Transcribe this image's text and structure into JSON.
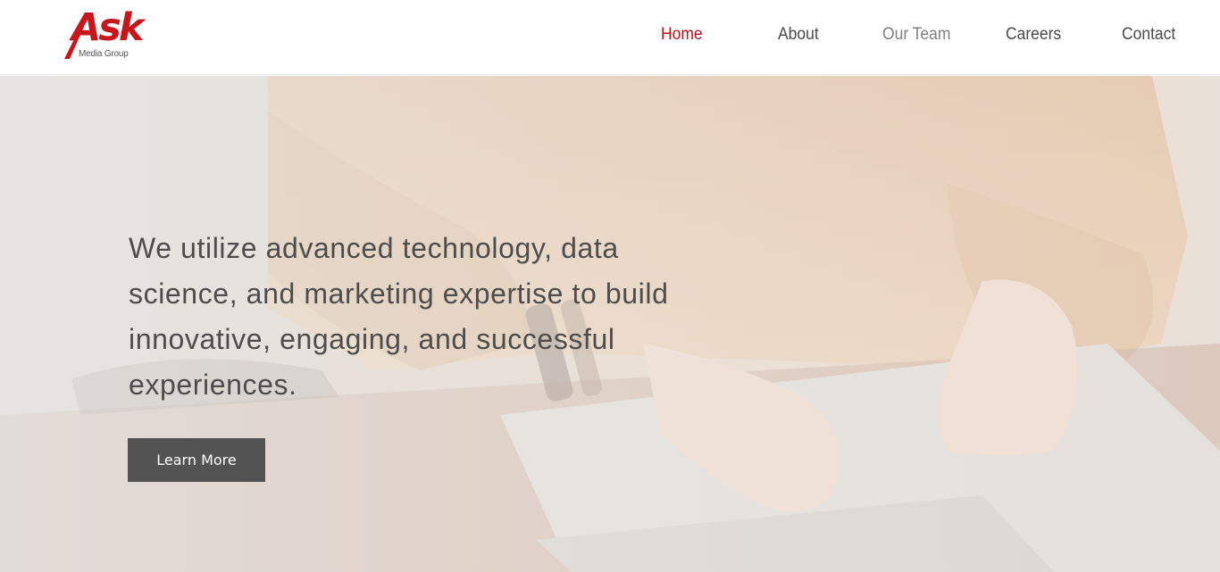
{
  "brand": {
    "logo_word": "Ask",
    "logo_sub": "Media Group",
    "accent_color": "#c8161d"
  },
  "nav": {
    "items": [
      {
        "label": "Home",
        "state": "active"
      },
      {
        "label": "About",
        "state": "normal"
      },
      {
        "label": "Our Team",
        "state": "muted"
      },
      {
        "label": "Careers",
        "state": "normal"
      },
      {
        "label": "Contact",
        "state": "normal"
      }
    ]
  },
  "hero": {
    "headline": "We utilize advanced technology, data science, and marketing expertise to build innovative, engaging, and successful experiences.",
    "button_label": "Learn More"
  }
}
